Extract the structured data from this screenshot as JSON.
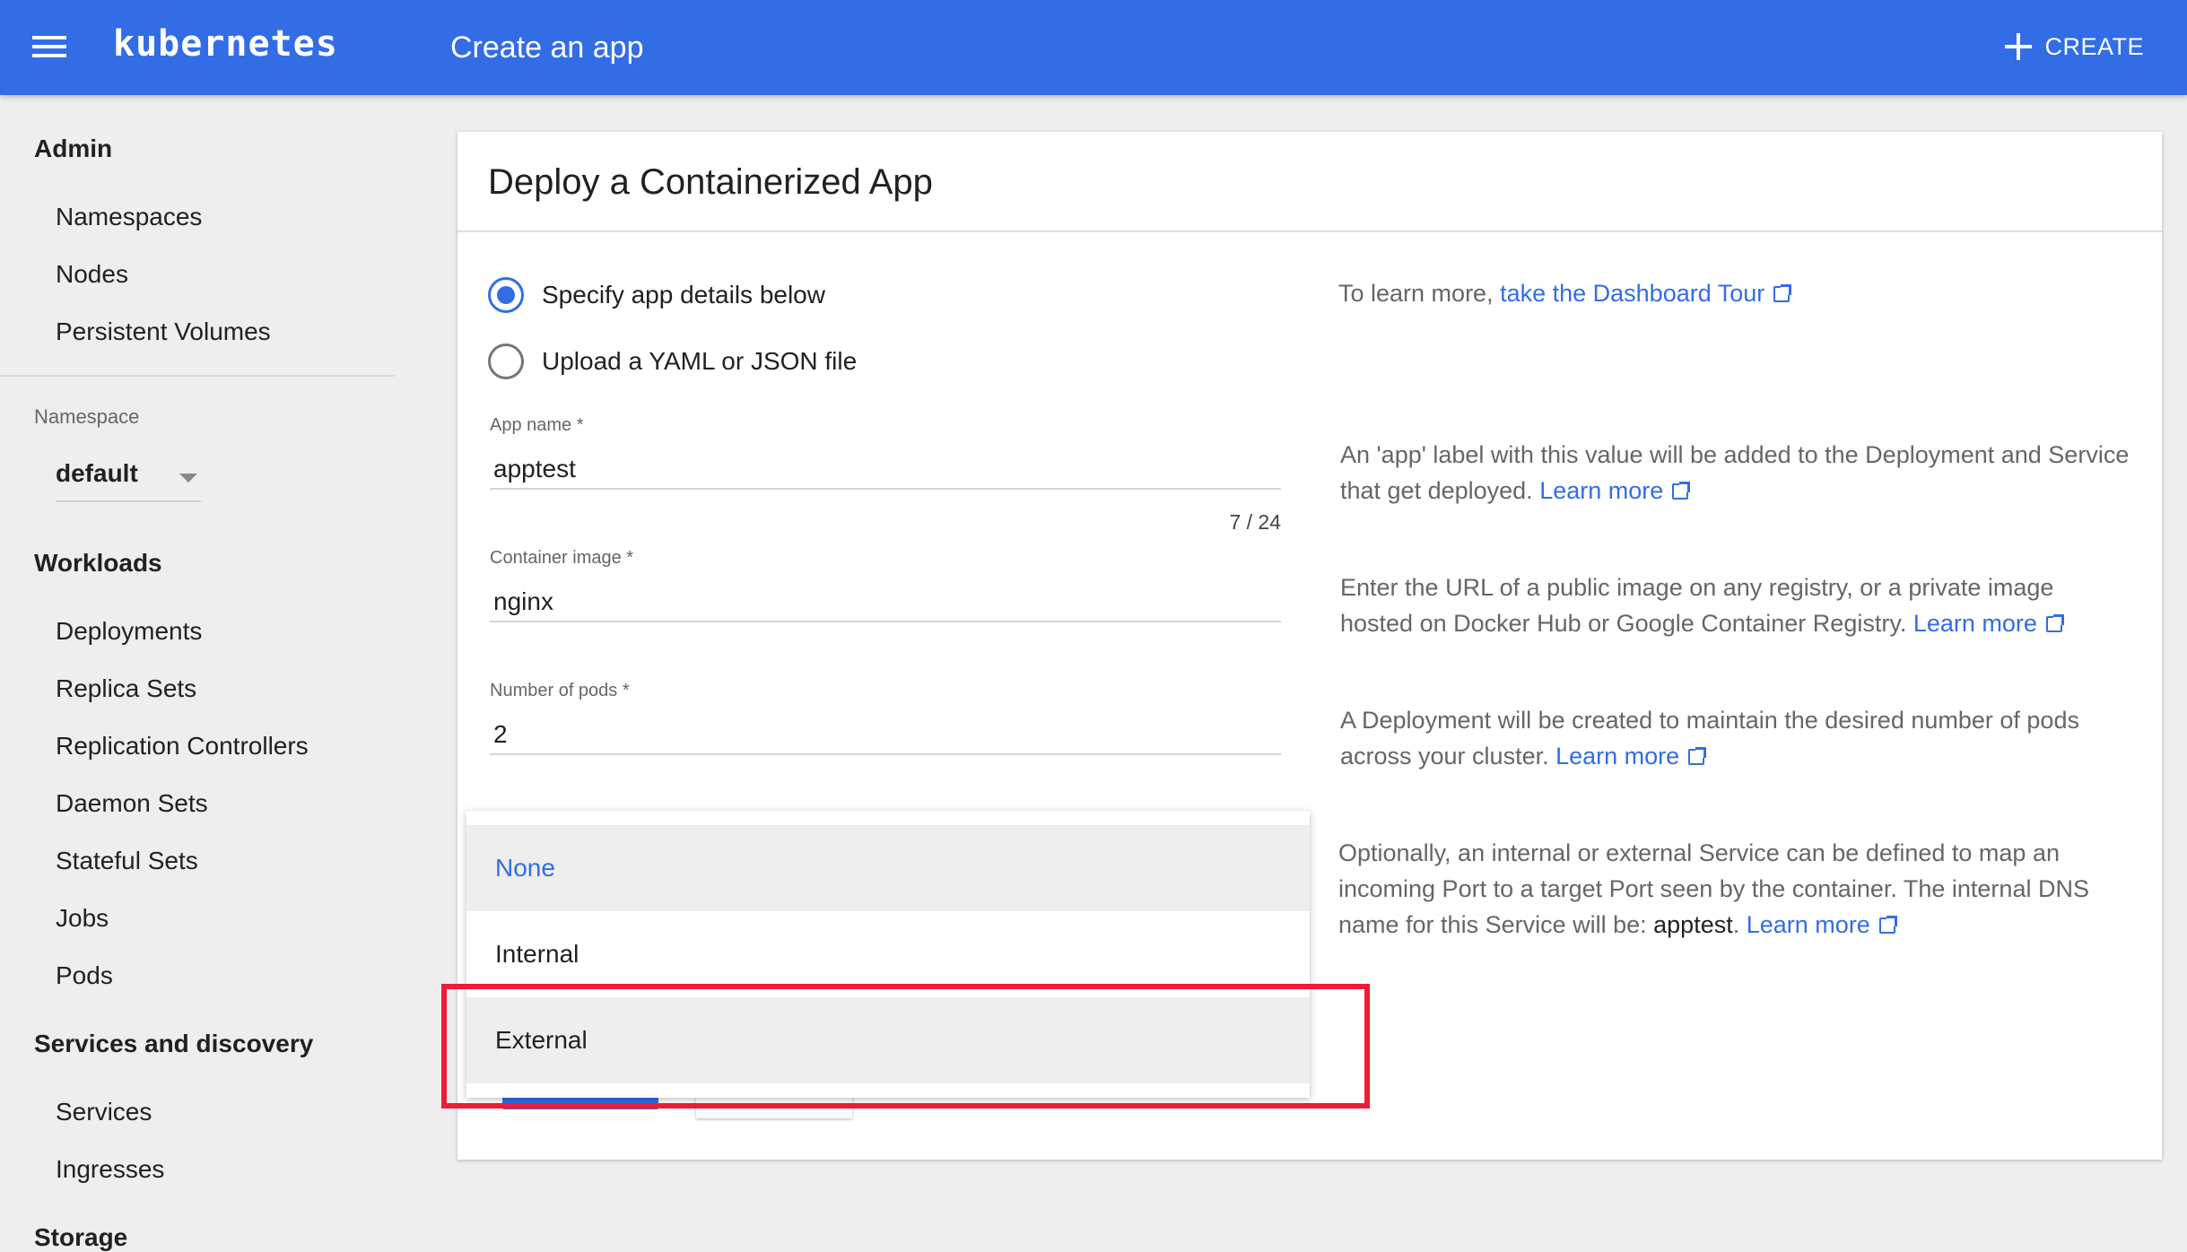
{
  "header": {
    "app_name": "kubernetes",
    "page_title": "Create an app",
    "create_label": "CREATE",
    "bar_color": "#326de6"
  },
  "sidebar": {
    "admin": {
      "title": "Admin",
      "items": [
        "Namespaces",
        "Nodes",
        "Persistent Volumes"
      ]
    },
    "namespace": {
      "label": "Namespace",
      "value": "default"
    },
    "workloads": {
      "title": "Workloads",
      "items": [
        "Deployments",
        "Replica Sets",
        "Replication Controllers",
        "Daemon Sets",
        "Stateful Sets",
        "Jobs",
        "Pods"
      ]
    },
    "services": {
      "title": "Services and discovery",
      "items": [
        "Services",
        "Ingresses"
      ]
    },
    "storage": {
      "title": "Storage"
    }
  },
  "card": {
    "title": "Deploy a Containerized App",
    "options": {
      "specify": "Specify app details below",
      "upload": "Upload a YAML or JSON file",
      "selected": "specify"
    },
    "tour": {
      "prefix": "To learn more, ",
      "link": "take the Dashboard Tour"
    },
    "app_name": {
      "label": "App name *",
      "value": "apptest",
      "count": "7 / 24",
      "help": "An 'app' label with this value will be added to the Deployment and Service that get deployed.",
      "link": "Learn more"
    },
    "container_image": {
      "label": "Container image *",
      "value": "nginx",
      "help": "Enter the URL of a public image on any registry, or a private image hosted on Docker Hub or Google Container Registry.",
      "link": "Learn more"
    },
    "pods": {
      "label": "Number of pods *",
      "value": "2",
      "help": "A Deployment will be created to maintain the desired number of pods across your cluster.",
      "link": "Learn more"
    },
    "service": {
      "help": "Optionally, an internal or external Service can be defined to map an incoming Port to a target Port seen by the container. The internal DNS name for this Service will be: ",
      "dns_name": "apptest",
      "period": ".",
      "link": "Learn more"
    }
  },
  "service_dropdown": {
    "options": [
      "None",
      "Internal",
      "External"
    ],
    "selected": "None",
    "highlighted": "External",
    "highlight_color": "#ee1c34"
  }
}
